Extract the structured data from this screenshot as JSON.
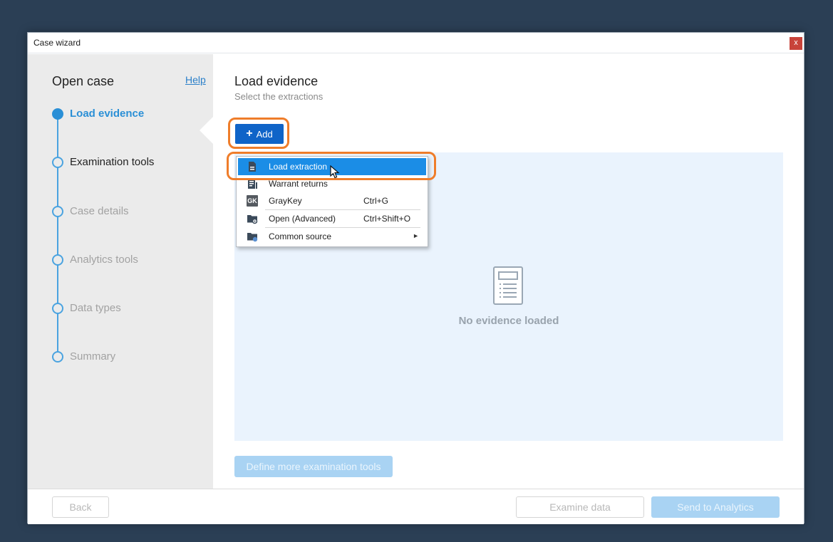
{
  "window": {
    "title": "Case wizard",
    "close_label": "x"
  },
  "sidebar": {
    "title": "Open case",
    "help_label": "Help",
    "steps": [
      {
        "label": "Load evidence",
        "state": "active"
      },
      {
        "label": "Examination tools",
        "state": "normal"
      },
      {
        "label": "Case details",
        "state": "disabled"
      },
      {
        "label": "Analytics tools",
        "state": "disabled"
      },
      {
        "label": "Data types",
        "state": "disabled"
      },
      {
        "label": "Summary",
        "state": "disabled"
      }
    ]
  },
  "main": {
    "title": "Load evidence",
    "subtitle": "Select the extractions",
    "add_button": {
      "icon": "plus-icon",
      "label": "Add"
    },
    "empty_state": {
      "icon": "document-icon",
      "text": "No evidence loaded"
    },
    "define_button_label": "Define more examination tools"
  },
  "menu": {
    "items": [
      {
        "label": "Load extraction",
        "shortcut": "",
        "icon": "extraction-icon",
        "hover": true
      },
      {
        "label": "Warrant returns",
        "shortcut": "",
        "icon": "warrant-icon"
      },
      {
        "label": "GrayKey",
        "shortcut": "Ctrl+G",
        "icon": "graykey-icon",
        "badge": "GK"
      },
      {
        "label": "Open (Advanced)",
        "shortcut": "Ctrl+Shift+O",
        "icon": "folder-gear-icon"
      },
      {
        "label": "Common source",
        "shortcut": "",
        "icon": "folder-source-icon",
        "submenu": true
      }
    ]
  },
  "footer": {
    "back_label": "Back",
    "examine_label": "Examine data",
    "send_label": "Send to Analytics"
  },
  "colors": {
    "accent": "#0f64c8",
    "highlight": "#ef7d2a",
    "menu_hover": "#1b8de6",
    "step_active": "#2a8fd6"
  }
}
